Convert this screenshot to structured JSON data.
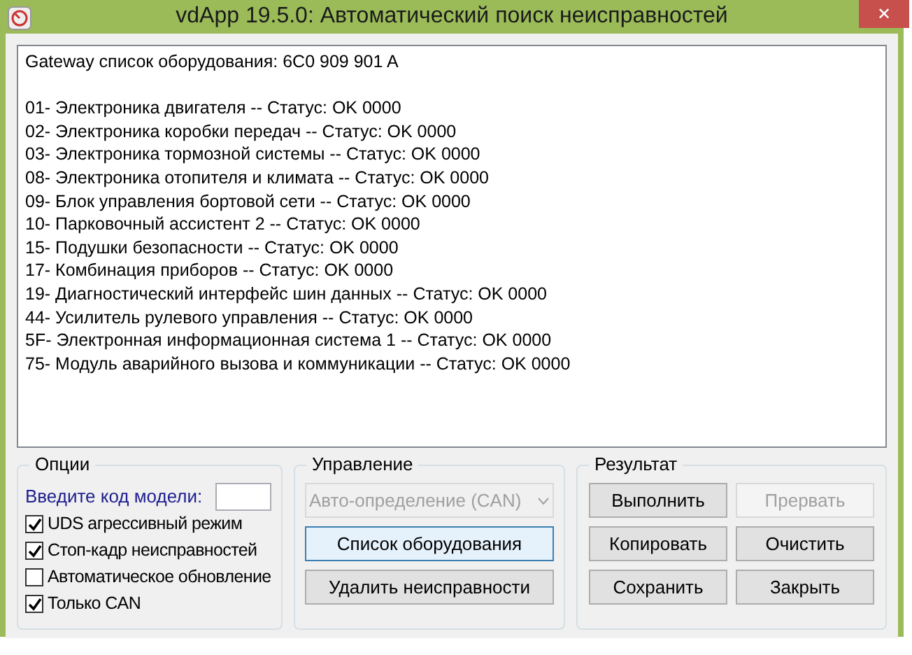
{
  "window": {
    "title": "vdApp 19.5.0:  Автоматический поиск неисправностей",
    "close": "✕"
  },
  "log": {
    "header": "Gateway список оборудования:  6C0 909 901 A",
    "lines": [
      "01- Электроника двигателя -- Статус: OK 0000",
      "02- Электроника коробки передач -- Статус: OK 0000",
      "03- Электроника тормозной системы -- Статус: OK 0000",
      "08- Электроника отопителя и климата -- Статус: OK 0000",
      "09- Блок управления бортовой сети -- Статус: OK 0000",
      "10- Парковочный ассистент 2 -- Статус: OK 0000",
      "15- Подушки безопасности -- Статус: OK 0000",
      "17- Комбинация приборов -- Статус: OK 0000",
      "19- Диагностический интерфейс шин данных -- Статус: OK 0000",
      "44- Усилитель рулевого управления -- Статус: OK 0000",
      "5F- Электронная информационная система 1 -- Статус: OK 0000",
      "75- Модуль аварийного вызова и коммуникации -- Статус: OK 0000"
    ]
  },
  "options": {
    "title": "Опции",
    "model_label": "Введите код модели:",
    "checkboxes": [
      {
        "label": "UDS агрессивный режим",
        "checked": true
      },
      {
        "label": "Стоп-кадр неисправностей",
        "checked": true
      },
      {
        "label": "Автоматическое обновление",
        "checked": false
      },
      {
        "label": "Только CAN",
        "checked": true
      }
    ]
  },
  "control": {
    "title": "Управление",
    "dropdown": {
      "value": "Авто-определение (CAN)",
      "disabled": true
    },
    "buttons": [
      {
        "label": "Список оборудования",
        "focused": true
      },
      {
        "label": "Удалить неисправности",
        "focused": false
      }
    ]
  },
  "result": {
    "title": "Результат",
    "buttons": [
      {
        "label": "Выполнить",
        "disabled": false
      },
      {
        "label": "Прервать",
        "disabled": true
      },
      {
        "label": "Копировать",
        "disabled": false
      },
      {
        "label": "Очистить",
        "disabled": false
      },
      {
        "label": "Сохранить",
        "disabled": false
      },
      {
        "label": "Закрыть",
        "disabled": false
      }
    ]
  }
}
